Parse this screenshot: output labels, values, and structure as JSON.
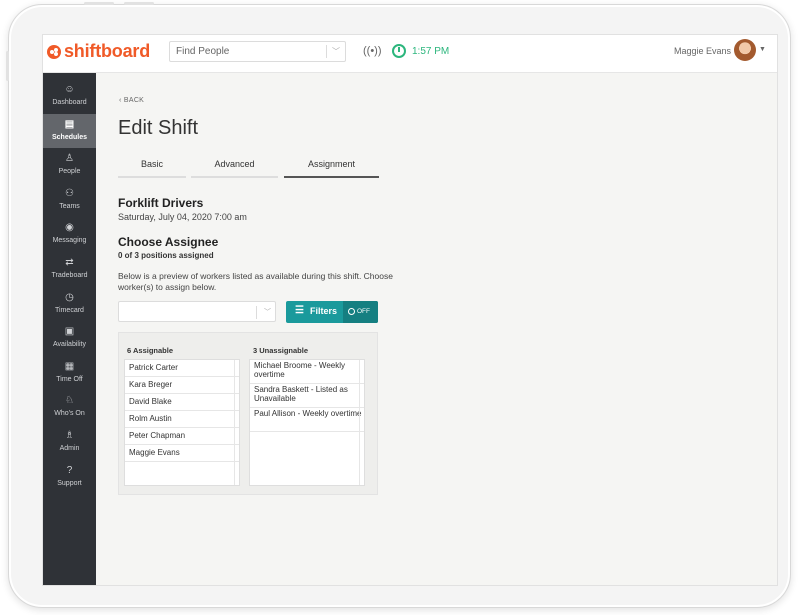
{
  "topbar": {
    "logo_text": "shiftboard",
    "search_placeholder": "Find People",
    "time": "1:57 PM",
    "user_name": "Maggie Evans"
  },
  "sidebar": {
    "items": [
      {
        "label": "Dashboard",
        "icon": "dashboard-icon",
        "glyph": "☺",
        "active": false
      },
      {
        "label": "Schedules",
        "icon": "calendar-icon",
        "glyph": "▤",
        "active": true
      },
      {
        "label": "People",
        "icon": "person-icon",
        "glyph": "♙",
        "active": false
      },
      {
        "label": "Teams",
        "icon": "team-icon",
        "glyph": "⚇",
        "active": false
      },
      {
        "label": "Messaging",
        "icon": "broadcast-icon",
        "glyph": "◉",
        "active": false
      },
      {
        "label": "Tradeboard",
        "icon": "swap-icon",
        "glyph": "⇄",
        "active": false
      },
      {
        "label": "Timecard",
        "icon": "stopwatch-icon",
        "glyph": "◷",
        "active": false
      },
      {
        "label": "Availability",
        "icon": "calendar-check-icon",
        "glyph": "▣",
        "active": false
      },
      {
        "label": "Time Off",
        "icon": "calendar-off-icon",
        "glyph": "▦",
        "active": false
      },
      {
        "label": "Who's On",
        "icon": "people-search-icon",
        "glyph": "♘",
        "active": false
      },
      {
        "label": "Admin",
        "icon": "admin-icon",
        "glyph": "♗",
        "active": false
      },
      {
        "label": "Support",
        "icon": "help-icon",
        "glyph": "?",
        "active": false
      }
    ]
  },
  "page": {
    "back_label": "BACK",
    "title": "Edit Shift",
    "tabs": [
      {
        "label": "Basic",
        "active": false
      },
      {
        "label": "Advanced",
        "active": false
      },
      {
        "label": "Assignment",
        "active": true
      }
    ],
    "shift_name": "Forklift Drivers",
    "shift_date": "Saturday, July 04, 2020 7:00 am",
    "choose_heading": "Choose Assignee",
    "positions_text": "0 of 3 positions assigned",
    "preview_text": "Below is a preview of workers listed as available during this shift. Choose worker(s) to assign below.",
    "filters_label": "Filters",
    "toggle_label": "OFF",
    "assignable_header": "6 Assignable",
    "assignable": [
      "Patrick Carter",
      "Kara Breger",
      "David Blake",
      "Rolm Austin",
      "Peter Chapman",
      "Maggie Evans"
    ],
    "unassignable_header": "3 Unassignable",
    "unassignable": [
      "Michael Broome - Weekly overtime",
      "Sandra Baskett - Listed as Unavailable",
      "Paul Allison - Weekly overtime"
    ]
  },
  "colors": {
    "brand": "#f05a28",
    "accent": "#1a9a9c",
    "clock": "#2cb67d",
    "sidebar": "#2f3237"
  }
}
